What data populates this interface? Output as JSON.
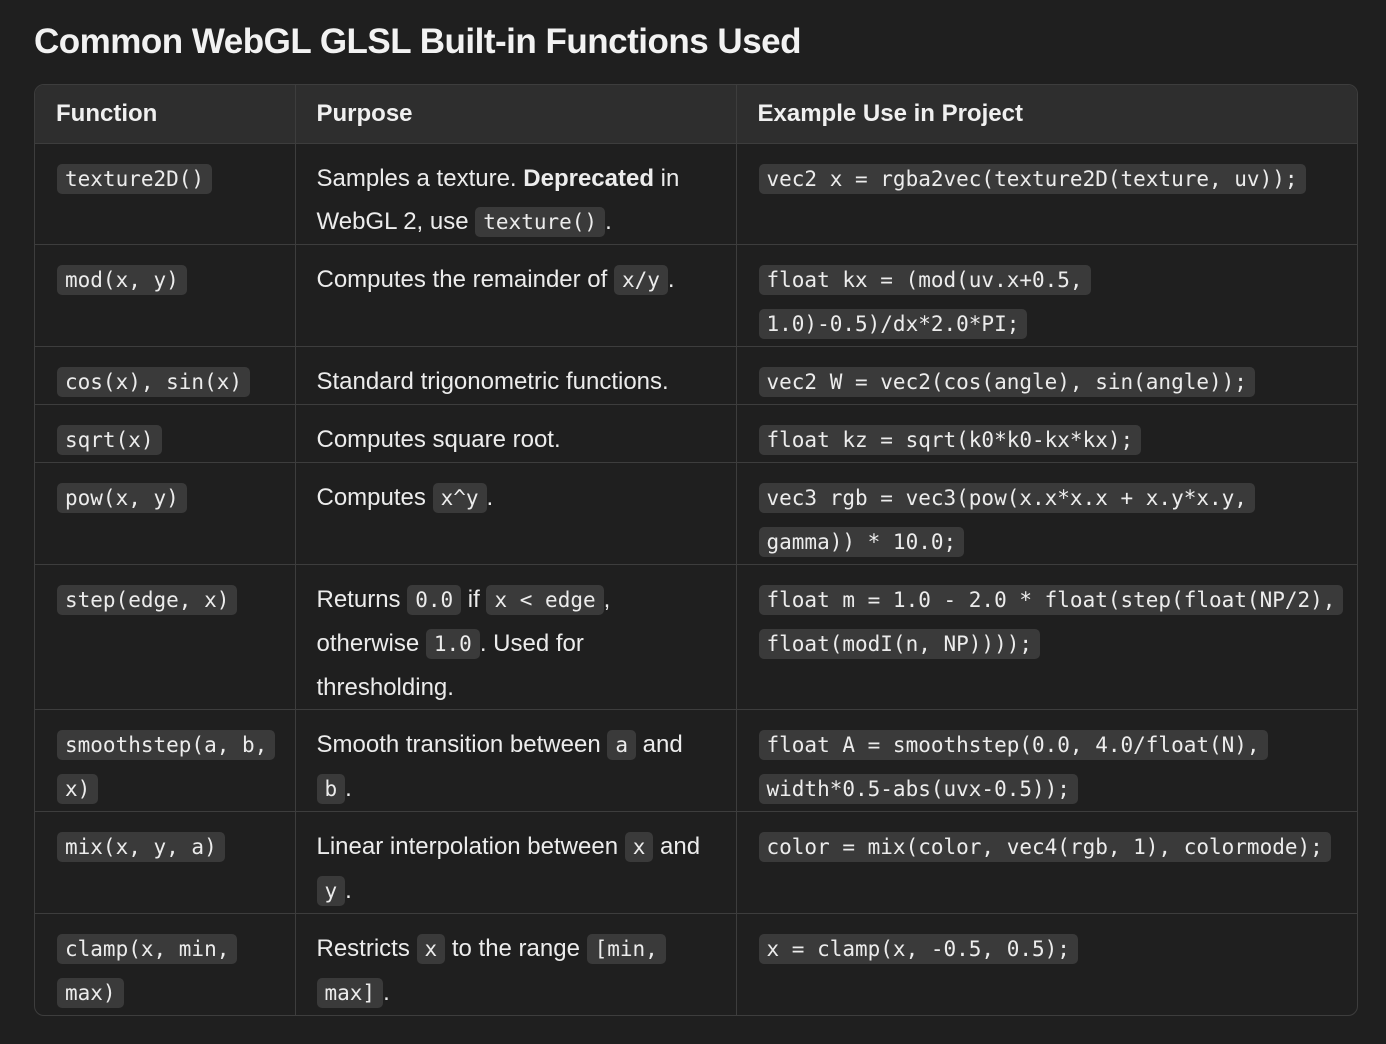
{
  "title": "Common WebGL GLSL Built-in Functions Used",
  "headers": {
    "function": "Function",
    "purpose": "Purpose",
    "example": "Example Use in Project"
  },
  "rows": [
    {
      "function": "texture2D()",
      "purpose": [
        {
          "t": "text",
          "v": "Samples a texture. "
        },
        {
          "t": "bold",
          "v": "Deprecated"
        },
        {
          "t": "text",
          "v": " in WebGL 2, use "
        },
        {
          "t": "code",
          "v": "texture()"
        },
        {
          "t": "text",
          "v": "."
        }
      ],
      "example": "vec2 x = rgba2vec(texture2D(texture, uv));"
    },
    {
      "function": "mod(x, y)",
      "purpose": [
        {
          "t": "text",
          "v": "Computes the remainder of "
        },
        {
          "t": "code",
          "v": "x/y"
        },
        {
          "t": "text",
          "v": "."
        }
      ],
      "example": "float kx = (mod(uv.x+0.5, 1.0)-0.5)/dx*2.0*PI;"
    },
    {
      "function": "cos(x), sin(x)",
      "purpose": [
        {
          "t": "text",
          "v": "Standard trigonometric functions."
        }
      ],
      "example": "vec2 W = vec2(cos(angle), sin(angle));"
    },
    {
      "function": "sqrt(x)",
      "purpose": [
        {
          "t": "text",
          "v": "Computes square root."
        }
      ],
      "example": "float kz = sqrt(k0*k0-kx*kx);"
    },
    {
      "function": "pow(x, y)",
      "purpose": [
        {
          "t": "text",
          "v": "Computes "
        },
        {
          "t": "code",
          "v": "x^y"
        },
        {
          "t": "text",
          "v": "."
        }
      ],
      "example": "vec3 rgb = vec3(pow(x.x*x.x + x.y*x.y, gamma)) * 10.0;"
    },
    {
      "function": "step(edge, x)",
      "purpose": [
        {
          "t": "text",
          "v": "Returns "
        },
        {
          "t": "code",
          "v": "0.0"
        },
        {
          "t": "text",
          "v": " if "
        },
        {
          "t": "code",
          "v": "x < edge"
        },
        {
          "t": "text",
          "v": ", otherwise "
        },
        {
          "t": "code",
          "v": "1.0"
        },
        {
          "t": "text",
          "v": ". Used for thresholding."
        }
      ],
      "example": "float m = 1.0 - 2.0 * float(step(float(NP/2), float(modI(n, NP))));"
    },
    {
      "function": "smoothstep(a, b, x)",
      "purpose": [
        {
          "t": "text",
          "v": "Smooth transition between "
        },
        {
          "t": "code",
          "v": "a"
        },
        {
          "t": "text",
          "v": " and "
        },
        {
          "t": "code",
          "v": "b"
        },
        {
          "t": "text",
          "v": "."
        }
      ],
      "example": "float A = smoothstep(0.0, 4.0/float(N), width*0.5-abs(uvx-0.5));"
    },
    {
      "function": "mix(x, y, a)",
      "purpose": [
        {
          "t": "text",
          "v": "Linear interpolation between "
        },
        {
          "t": "code",
          "v": "x"
        },
        {
          "t": "text",
          "v": " and "
        },
        {
          "t": "code",
          "v": "y"
        },
        {
          "t": "text",
          "v": "."
        }
      ],
      "example": "color = mix(color, vec4(rgb, 1), colormode);"
    },
    {
      "function": "clamp(x, min, max)",
      "purpose": [
        {
          "t": "text",
          "v": "Restricts "
        },
        {
          "t": "code",
          "v": "x"
        },
        {
          "t": "text",
          "v": " to the range "
        },
        {
          "t": "code",
          "v": "[min, max]"
        },
        {
          "t": "text",
          "v": "."
        }
      ],
      "example": "x = clamp(x, -0.5, 0.5);"
    }
  ]
}
